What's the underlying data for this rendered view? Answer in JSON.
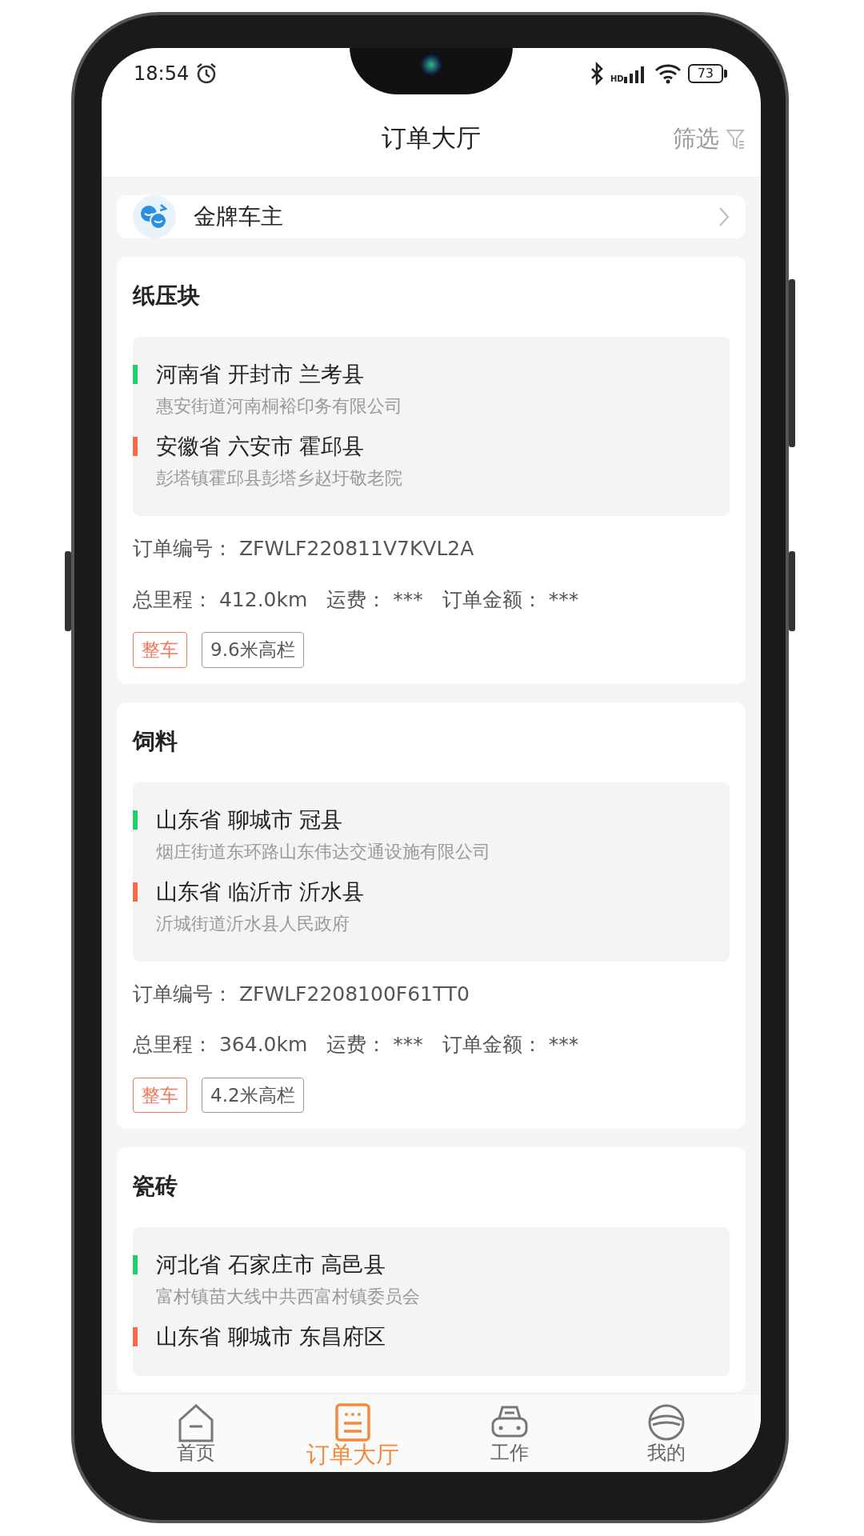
{
  "status_bar": {
    "time": "18:54",
    "network_label": "HD",
    "battery": "73"
  },
  "header": {
    "title": "订单大厅",
    "filter": "筛选"
  },
  "banner": {
    "label": "金牌车主"
  },
  "orders": [
    {
      "cargo": "纸压块",
      "stops": [
        {
          "kind": "origin",
          "region": "河南省 开封市 兰考县",
          "address": "惠安街道河南桐裕印务有限公司"
        },
        {
          "kind": "destination",
          "region": "安徽省 六安市 霍邱县",
          "address": "彭塔镇霍邱县彭塔乡赵圩敬老院"
        }
      ],
      "order_no_label": "订单编号：",
      "order_no": "ZFWLF220811V7KVL2A",
      "distance_label": "总里程：",
      "distance": "412.0km",
      "freight_label": "运费：",
      "freight": "***",
      "amount_label": "订单金额：",
      "amount": "***",
      "tags": [
        {
          "kind": "service",
          "text": "整车"
        },
        {
          "kind": "vehicle",
          "text": "9.6米高栏"
        }
      ]
    },
    {
      "cargo": "饲料",
      "stops": [
        {
          "kind": "origin",
          "region": "山东省 聊城市 冠县",
          "address": "烟庄街道东环路山东伟达交通设施有限公司"
        },
        {
          "kind": "destination",
          "region": "山东省 临沂市 沂水县",
          "address": "沂城街道沂水县人民政府"
        }
      ],
      "order_no_label": "订单编号：",
      "order_no": "ZFWLF2208100F61TT0",
      "distance_label": "总里程：",
      "distance": "364.0km",
      "freight_label": "运费：",
      "freight": "***",
      "amount_label": "订单金额：",
      "amount": "***",
      "tags": [
        {
          "kind": "service",
          "text": "整车"
        },
        {
          "kind": "vehicle",
          "text": "4.2米高栏"
        }
      ]
    },
    {
      "cargo": "瓷砖",
      "stops": [
        {
          "kind": "origin",
          "region": "河北省 石家庄市 高邑县",
          "address": "富村镇苗大线中共西富村镇委员会"
        },
        {
          "kind": "destination",
          "region": "山东省 聊城市 东昌府区"
        }
      ]
    }
  ],
  "nav": [
    {
      "kind": "home",
      "label": "首页",
      "selected": false
    },
    {
      "kind": "orders",
      "label": "订单大厅",
      "selected": true
    },
    {
      "kind": "car",
      "label": "工作",
      "selected": false
    },
    {
      "kind": "helmet",
      "label": "我的",
      "selected": false
    }
  ]
}
